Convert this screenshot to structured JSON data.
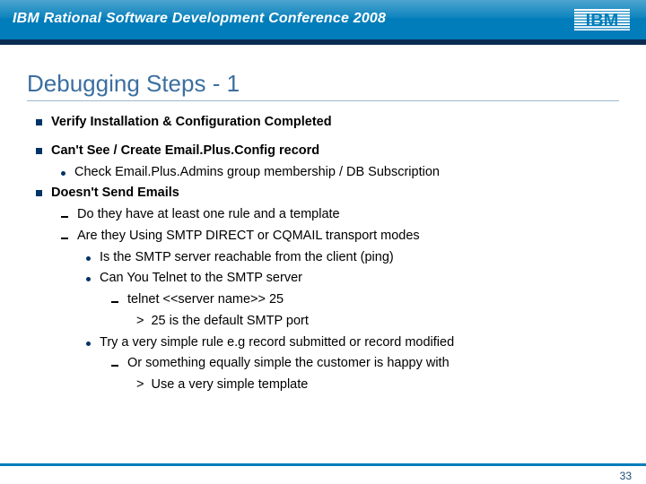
{
  "banner": {
    "title": "IBM Rational Software Development Conference 2008",
    "logo": "IBM"
  },
  "slide": {
    "title": "Debugging Steps - 1",
    "page_number": "33"
  },
  "bullets": {
    "b1": "Verify Installation & Configuration Completed",
    "b2": "Can't See / Create Email.Plus.Config record",
    "b2_1": "Check Email.Plus.Admins group membership / DB Subscription",
    "b3": "Doesn't Send Emails",
    "b3_1": "Do they have at least one rule and a template",
    "b3_2": "Are they Using SMTP DIRECT or CQMAIL transport modes",
    "b3_2_1": "Is the SMTP server reachable from the client (ping)",
    "b3_2_2": "Can You Telnet to the SMTP server",
    "b3_2_2_1": "telnet <<server name>> 25",
    "b3_2_2_2": "25 is the default SMTP port",
    "b3_2_3": "Try a very simple rule e.g record submitted or record modified",
    "b3_2_3_1": "Or something equally simple the customer is happy with",
    "b3_2_3_1_1": "Use a very simple template"
  }
}
